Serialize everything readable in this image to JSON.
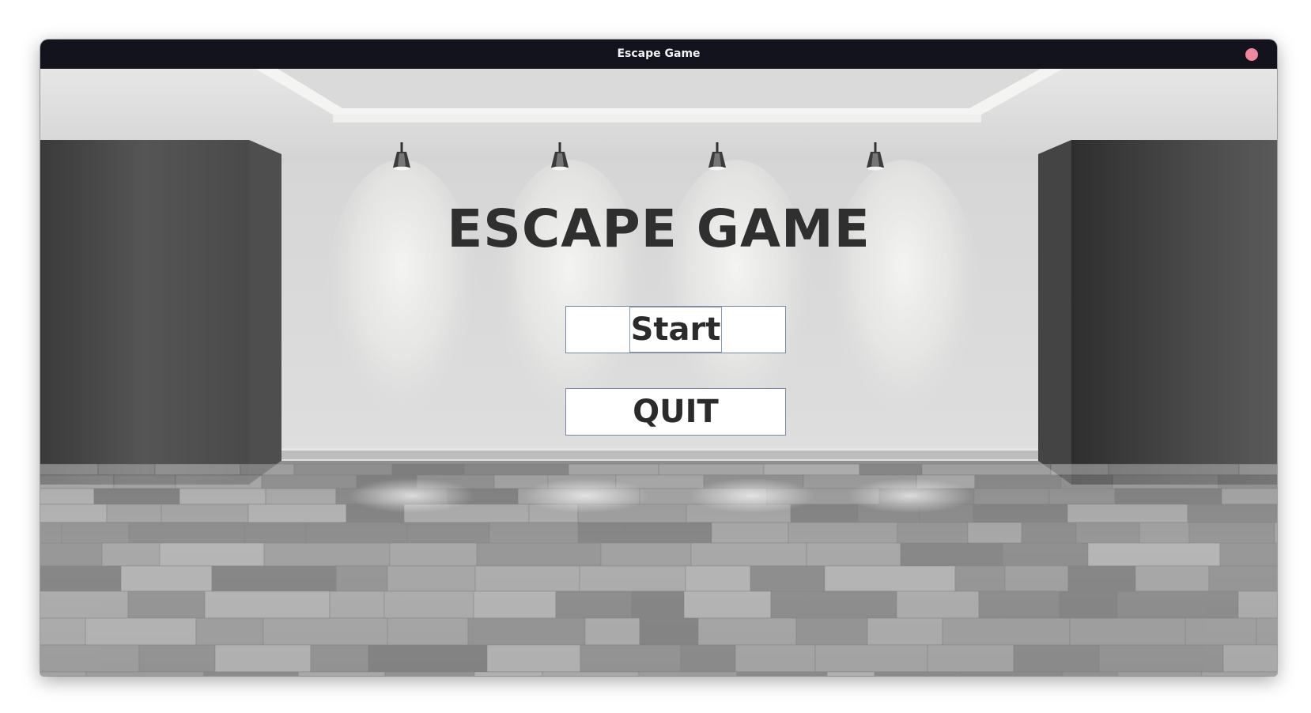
{
  "window": {
    "title": "Escape Game"
  },
  "game": {
    "title": "ESCAPE GAME"
  },
  "menu": {
    "start_label": "Start",
    "quit_label": "QUIT"
  },
  "colors": {
    "titlebar": "#12131d",
    "close_button": "#f1879d",
    "title_text": "#2f2f2f",
    "wall_panel": "#3a3a3a",
    "back_wall": "#dcdcdc",
    "floor": "#9c9c9c"
  },
  "icons": {
    "close": "close-dot-icon",
    "lamp": "spotlight-lamp-icon"
  }
}
